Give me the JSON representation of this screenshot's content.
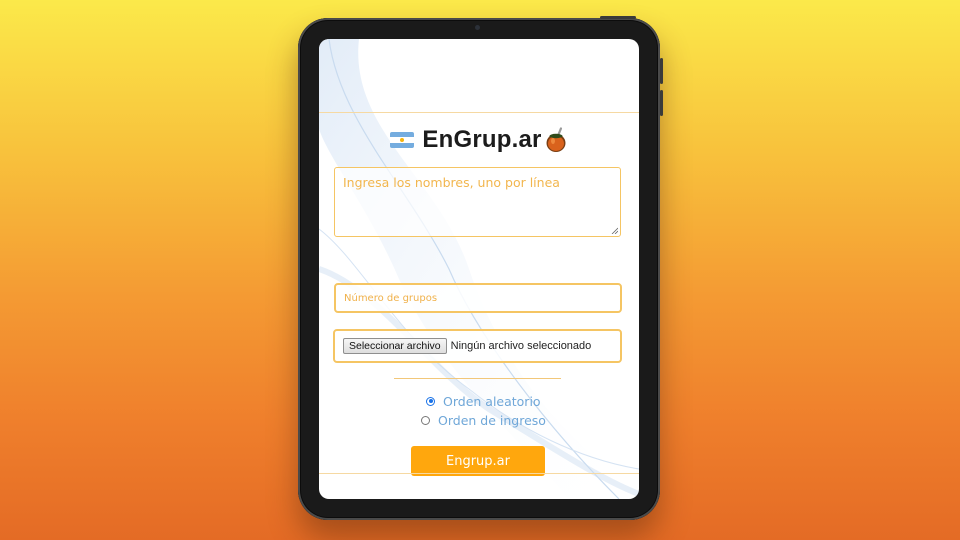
{
  "app": {
    "title": "EnGrup.ar",
    "flag_icon": "argentina-flag-icon",
    "logo_icon": "mate-gourd-icon"
  },
  "form": {
    "names_placeholder": "Ingresa los nombres, uno por línea",
    "groups_placeholder": "Número de grupos",
    "file_button_label": "Seleccionar archivo",
    "file_status": "Ningún archivo seleccionado",
    "order_options": [
      {
        "label": "Orden aleatorio",
        "selected": true
      },
      {
        "label": "Orden de ingreso",
        "selected": false
      }
    ],
    "submit_label": "Engrup.ar"
  },
  "colors": {
    "accent": "#ffa70d",
    "border": "#f5c563",
    "placeholder": "#f2b64e",
    "radio_label": "#6fa7d8"
  }
}
